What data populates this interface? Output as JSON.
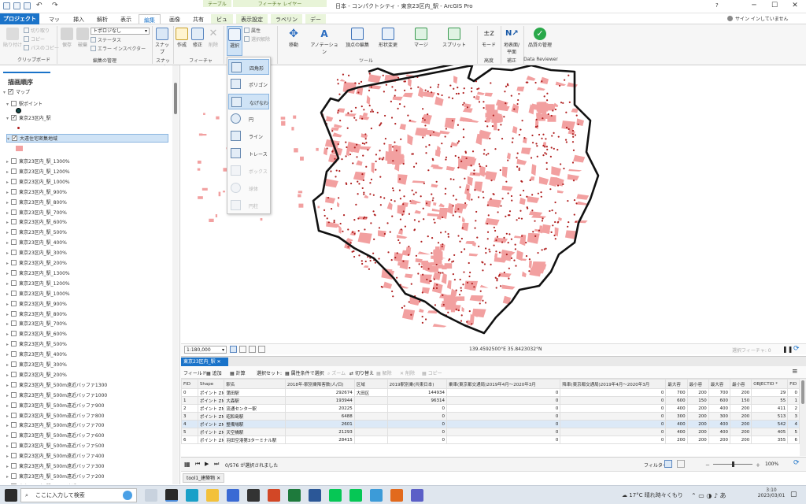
{
  "window": {
    "title": "日本 - コンパクトシティ - 東京23区内_駅 - ArcGIS Pro",
    "signin": "サイン インしていません",
    "help": "?"
  },
  "context_groups": {
    "table": "テーブル",
    "feature_layer": "フィーチャ レイヤー"
  },
  "tabs": [
    "プロジェクト",
    "マップ",
    "挿入",
    "解析",
    "表示",
    "編集",
    "画像",
    "共有",
    "ビュー",
    "表示設定",
    "ラベリング",
    "データ"
  ],
  "ribbon": {
    "clipboard": {
      "paste": "貼り付け",
      "cut": "切り取り",
      "copy": "コピー",
      "copy_path": "パスのコピー",
      "group": "クリップボード"
    },
    "edit_mgmt": {
      "save": "保存",
      "discard": "破棄",
      "topology": "トポロジなし",
      "status": "ステータス",
      "error_inspector": "エラー インスペクター",
      "group": "編集の管理"
    },
    "snap": {
      "label": "スナップ",
      "group": "スナップ"
    },
    "features": {
      "create": "作成",
      "modify": "修正",
      "delete": "削除",
      "group": "フィーチャ"
    },
    "select": {
      "label": "選択",
      "attributes": "属性",
      "clear": "選択解除"
    },
    "tools": {
      "move": "移動",
      "annotation": "アノテーション",
      "vertices": "頂点の編集",
      "reshape": "形状変更",
      "merge": "マージ",
      "split": "スプリット",
      "group": "ツール"
    },
    "elevation": {
      "mode": "モード",
      "group": "高度"
    },
    "correction": {
      "label": "地表面/平面",
      "group": "補正"
    },
    "quality": {
      "label": "品質の管理",
      "group": "Data Reviewer"
    }
  },
  "select_menu": [
    "四角形",
    "ポリゴン",
    "なげなわ",
    "円",
    "ライン",
    "トレース",
    "ボックス",
    "球体",
    "円柱"
  ],
  "contents": {
    "title": "描画順序",
    "layers": [
      {
        "label": "マップ",
        "checked": true
      },
      {
        "label": "駅ポイント",
        "checked": false
      },
      {
        "label": "東京23区内_駅",
        "checked": true
      },
      {
        "label": "大遠住宅密集地域",
        "checked": true
      },
      {
        "label": "東京23区内_駅_1300%",
        "checked": false
      },
      {
        "label": "東京23区内_駅_1200%",
        "checked": false
      },
      {
        "label": "東京23区内_駅_1000%",
        "checked": false
      },
      {
        "label": "東京23区内_駅_900%",
        "checked": false
      },
      {
        "label": "東京23区内_駅_800%",
        "checked": false
      },
      {
        "label": "東京23区内_駅_700%",
        "checked": false
      },
      {
        "label": "東京23区内_駅_600%",
        "checked": false
      },
      {
        "label": "東京23区内_駅_500%",
        "checked": false
      },
      {
        "label": "東京23区内_駅_400%",
        "checked": false
      },
      {
        "label": "東京23区内_駅_300%",
        "checked": false
      },
      {
        "label": "東京23区内_駅_200%",
        "checked": false
      },
      {
        "label": "東京23区内_駅_1300%",
        "checked": false
      },
      {
        "label": "東京23区内_駅_1200%",
        "checked": false
      },
      {
        "label": "東京23区内_駅_1000%",
        "checked": false
      },
      {
        "label": "東京23区内_駅_900%",
        "checked": false
      },
      {
        "label": "東京23区内_駅_800%",
        "checked": false
      },
      {
        "label": "東京23区内_駅_700%",
        "checked": false
      },
      {
        "label": "東京23区内_駅_600%",
        "checked": false
      },
      {
        "label": "東京23区内_駅_500%",
        "checked": false
      },
      {
        "label": "東京23区内_駅_400%",
        "checked": false
      },
      {
        "label": "東京23区内_駅_300%",
        "checked": false
      },
      {
        "label": "東京23区内_駅_200%",
        "checked": false
      },
      {
        "label": "東京23区内_駅_500m遠近バッファ1300",
        "checked": false
      },
      {
        "label": "東京23区内_駅_500m遠近バッファ1000",
        "checked": false
      },
      {
        "label": "東京23区内_駅_500m遠近バッファ900",
        "checked": false
      },
      {
        "label": "東京23区内_駅_500m遠近バッファ800",
        "checked": false
      },
      {
        "label": "東京23区内_駅_500m遠近バッファ700",
        "checked": false
      },
      {
        "label": "東京23区内_駅_500m遠近バッファ600",
        "checked": false
      },
      {
        "label": "東京23区内_駅_500m遠近バッファ500",
        "checked": false
      },
      {
        "label": "東京23区内_駅_500m遠近バッファ400",
        "checked": false
      },
      {
        "label": "東京23区内_駅_500m遠近バッファ300",
        "checked": false
      },
      {
        "label": "東京23区内_駅_500m遠近バッファ200",
        "checked": false
      },
      {
        "label": "東京23区内_駅_500m遠近バッファ100",
        "checked": false
      }
    ]
  },
  "map_status": {
    "scale": "1:180,000",
    "coords": "139.4592500°E 35.8423032°N",
    "selected_features": "選択フィーチャ: 0"
  },
  "table": {
    "tab": "東京23区内_駅",
    "toolbar": {
      "field": "フィールド:",
      "add": "追加",
      "calc": "計算",
      "selection": "選択セット:",
      "by_attr": "属性条件で選択",
      "zoom": "ズーム",
      "switch": "切り替え",
      "clear": "解除",
      "delete": "削除",
      "copy": "コピー"
    },
    "columns": [
      "FID",
      "Shape",
      "駅名",
      "2018年-駅別乗降客数(人/日)",
      "区域",
      "2019駅別乗(共東日本)",
      "乗車(東京都交通局)2019年4月～2020年3月",
      "降車(東京都交通局)2019年4月～2020年3月",
      "最大容",
      "最小容",
      "最大容",
      "最小容",
      "OBJECTID *",
      "FID"
    ],
    "rows": [
      [
        "0",
        "ポイント ZM",
        "蒲田駅",
        "292674",
        "大田区",
        "144934",
        "0",
        "0",
        "700",
        "200",
        "700",
        "200",
        "29",
        "0"
      ],
      [
        "1",
        "ポイント ZM",
        "大森駅",
        "193944",
        "",
        "96314",
        "0",
        "0",
        "600",
        "150",
        "600",
        "150",
        "55",
        "1"
      ],
      [
        "2",
        "ポイント ZM",
        "流通センター駅",
        "20225",
        "",
        "0",
        "0",
        "0",
        "400",
        "200",
        "400",
        "200",
        "411",
        "2"
      ],
      [
        "3",
        "ポイント ZM",
        "昭和島駅",
        "6488",
        "",
        "0",
        "0",
        "0",
        "300",
        "200",
        "300",
        "200",
        "513",
        "3"
      ],
      [
        "4",
        "ポイント ZM",
        "整備場駅",
        "2601",
        "",
        "0",
        "0",
        "0",
        "400",
        "200",
        "400",
        "200",
        "542",
        "4"
      ],
      [
        "5",
        "ポイント ZM",
        "天空橋駅",
        "21293",
        "",
        "0",
        "0",
        "0",
        "400",
        "200",
        "400",
        "200",
        "405",
        "5"
      ],
      [
        "6",
        "ポイント ZM",
        "羽田空港第3ターミナル駅",
        "28415",
        "",
        "0",
        "0",
        "0",
        "200",
        "200",
        "200",
        "200",
        "355",
        "6"
      ]
    ],
    "footer": {
      "count": "0/576 が選択されました",
      "filter": "フィルター:",
      "zoom": "100%"
    }
  },
  "bottom_tab": "tool1_建築物",
  "taskbar": {
    "search": "ここに入力して検索",
    "weather": "17°C  晴れ時々くもり",
    "time": "3:10",
    "date": "2023/03/01"
  },
  "colors": {
    "accent": "#1a73c9",
    "polygon": "#f2a0a0",
    "point": "#b02020",
    "boundary": "#111111"
  }
}
